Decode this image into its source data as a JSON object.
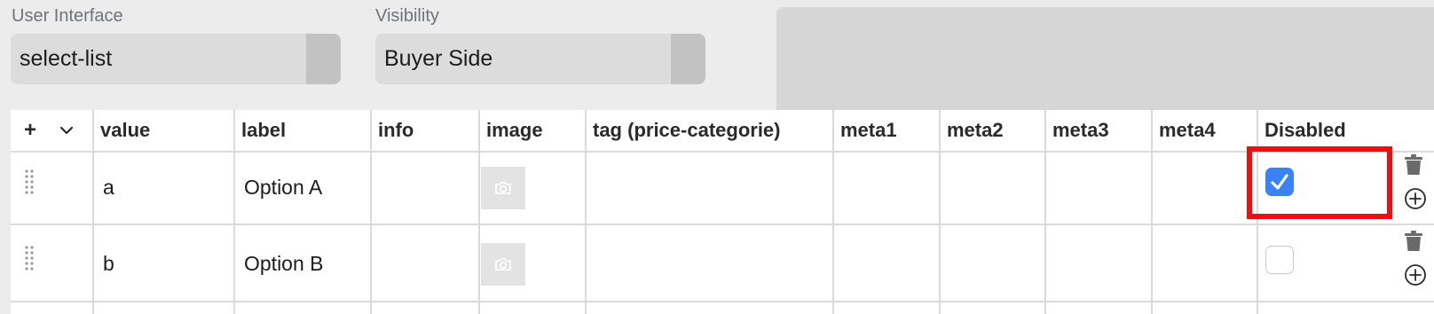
{
  "fields": {
    "user_interface": {
      "label": "User Interface",
      "value": "select-list"
    },
    "visibility": {
      "label": "Visibility",
      "value": "Buyer Side"
    }
  },
  "table": {
    "add_symbol": "+",
    "columns": [
      "value",
      "label",
      "info",
      "image",
      "tag (price-categorie)",
      "meta1",
      "meta2",
      "meta3",
      "meta4",
      "Disabled"
    ],
    "rows": [
      {
        "value": "a",
        "label": "Option A",
        "info": "",
        "disabled": true
      },
      {
        "value": "b",
        "label": "Option B",
        "info": "",
        "disabled": false
      }
    ]
  },
  "icons": {
    "add": "plus-icon",
    "collapse": "chevron-down-icon",
    "drag": "drag-handle-icon",
    "image": "camera-icon",
    "delete": "trash-icon",
    "insert": "circle-plus-icon"
  },
  "colors": {
    "checkbox_checked": "#3b82f6",
    "highlight": "#ee1010"
  }
}
